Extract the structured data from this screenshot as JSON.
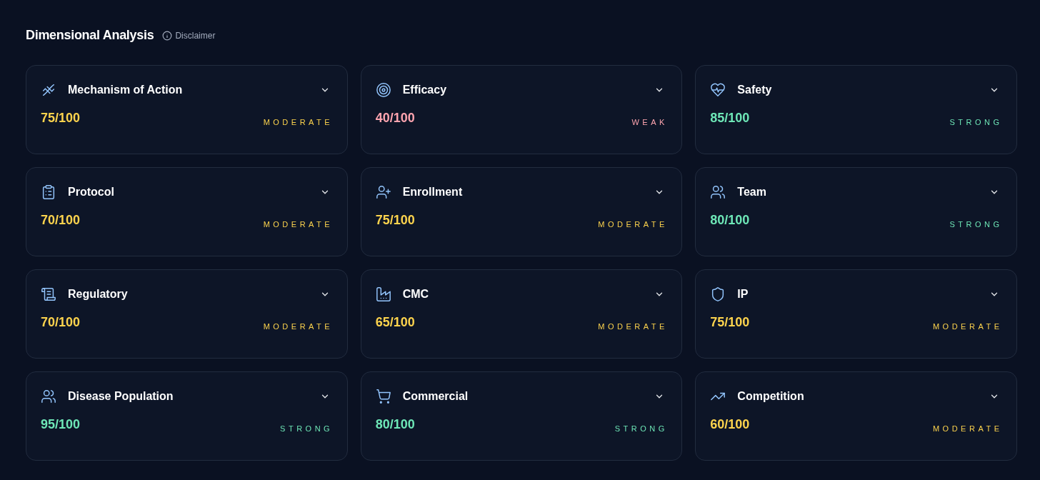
{
  "header": {
    "title": "Dimensional Analysis",
    "disclaimer": "Disclaimer"
  },
  "cards": [
    {
      "title": "Mechanism of Action",
      "score": "75/100",
      "rating": "MODERATE",
      "color": "#fcd34d",
      "expanded": false
    },
    {
      "title": "Efficacy",
      "score": "40/100",
      "rating": "WEAK",
      "color": "#fda4af",
      "expanded": false
    },
    {
      "title": "Safety",
      "score": "85/100",
      "rating": "STRONG",
      "color": "#6ee7b7",
      "expanded": false
    },
    {
      "title": "Protocol",
      "score": "70/100",
      "rating": "MODERATE",
      "color": "#fcd34d",
      "expanded": false
    },
    {
      "title": "Enrollment",
      "score": "75/100",
      "rating": "MODERATE",
      "color": "#fcd34d",
      "expanded": false
    },
    {
      "title": "Team",
      "score": "80/100",
      "rating": "STRONG",
      "color": "#6ee7b7",
      "expanded": false
    },
    {
      "title": "Regulatory",
      "score": "70/100",
      "rating": "MODERATE",
      "color": "#fcd34d",
      "expanded": false
    },
    {
      "title": "CMC",
      "score": "65/100",
      "rating": "MODERATE",
      "color": "#fcd34d",
      "expanded": false
    },
    {
      "title": "IP",
      "score": "75/100",
      "rating": "MODERATE",
      "color": "#fcd34d",
      "expanded": false
    },
    {
      "title": "Disease Population",
      "score": "95/100",
      "rating": "STRONG",
      "color": "#6ee7b7",
      "expanded": false
    },
    {
      "title": "Commercial",
      "score": "80/100",
      "rating": "STRONG",
      "color": "#6ee7b7",
      "expanded": false
    },
    {
      "title": "Competition",
      "score": "60/100",
      "rating": "MODERATE",
      "color": "#fcd34d",
      "expanded": false
    }
  ]
}
